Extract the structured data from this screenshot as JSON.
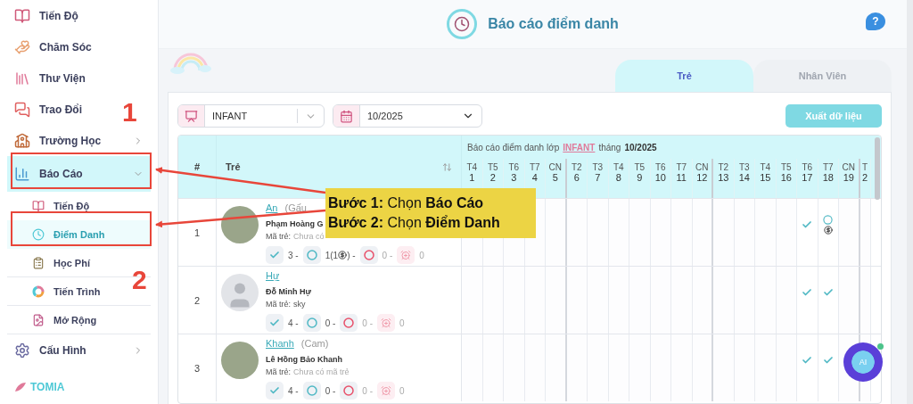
{
  "sidebar": {
    "items": [
      {
        "label": "Tiến Độ",
        "selected": false
      },
      {
        "label": "Chăm Sóc",
        "selected": false
      },
      {
        "label": "Thư Viện",
        "selected": false
      },
      {
        "label": "Trao Đổi",
        "selected": false
      },
      {
        "label": "Trường Học",
        "selected": false,
        "expanded": false
      },
      {
        "label": "Báo Cáo",
        "selected": true,
        "expanded": true,
        "children": [
          {
            "label": "Tiến Độ",
            "selected": false
          },
          {
            "label": "Điểm Danh",
            "selected": true
          },
          {
            "label": "Học Phí",
            "selected": false
          },
          {
            "label": "Tiến Trình",
            "selected": false
          },
          {
            "label": "Mở Rộng",
            "selected": false
          }
        ]
      },
      {
        "label": "Cấu Hình",
        "selected": false,
        "expanded": false
      }
    ],
    "logo": "TOMIA"
  },
  "header": {
    "title": "Báo cáo điểm danh",
    "help": "?"
  },
  "tabs": [
    {
      "label": "Trẻ",
      "selected": true
    },
    {
      "label": "Nhân Viên",
      "selected": false
    }
  ],
  "filters": {
    "class": "INFANT",
    "month": "10/2025"
  },
  "export_button": "Xuất dữ liệu",
  "table": {
    "columns": [
      "#",
      "Trẻ"
    ],
    "caption": {
      "prefix": "Báo cáo điểm danh lớp",
      "class": "INFANT",
      "middle": "tháng",
      "month": "10/2025"
    },
    "days": [
      {
        "weekday": "T4",
        "day": "1",
        "week_end": false
      },
      {
        "weekday": "T5",
        "day": "2",
        "week_end": false
      },
      {
        "weekday": "T6",
        "day": "3",
        "week_end": false
      },
      {
        "weekday": "T7",
        "day": "4",
        "week_end": false
      },
      {
        "weekday": "CN",
        "day": "5",
        "week_end": true
      },
      {
        "weekday": "T2",
        "day": "6",
        "week_end": false
      },
      {
        "weekday": "T3",
        "day": "7",
        "week_end": false
      },
      {
        "weekday": "T4",
        "day": "8",
        "week_end": false
      },
      {
        "weekday": "T5",
        "day": "9",
        "week_end": false
      },
      {
        "weekday": "T6",
        "day": "10",
        "week_end": false
      },
      {
        "weekday": "T7",
        "day": "11",
        "week_end": false
      },
      {
        "weekday": "CN",
        "day": "12",
        "week_end": true
      },
      {
        "weekday": "T2",
        "day": "13",
        "week_end": false
      },
      {
        "weekday": "T3",
        "day": "14",
        "week_end": false
      },
      {
        "weekday": "T4",
        "day": "15",
        "week_end": false
      },
      {
        "weekday": "T5",
        "day": "16",
        "week_end": false
      },
      {
        "weekday": "T6",
        "day": "17",
        "week_end": false
      },
      {
        "weekday": "T7",
        "day": "18",
        "week_end": false
      },
      {
        "weekday": "CN",
        "day": "19",
        "week_end": true
      },
      {
        "weekday": "T",
        "day": "2",
        "week_end": false
      }
    ],
    "rows": [
      {
        "index": "1",
        "avatar": {
          "kind": "photo"
        },
        "name": "An",
        "nickname": "(Gấu",
        "full_name": "Phạm Hoàng G",
        "code_label": "Mã trẻ:",
        "code": "Chưa có",
        "code_empty": true,
        "summary": [
          {
            "kind": "present",
            "text": "3 -"
          },
          {
            "kind": "excused",
            "text": "1(1",
            "suffix": ") -"
          },
          {
            "kind": "absent",
            "text": "0 -"
          },
          {
            "kind": "leave",
            "text": "0"
          }
        ],
        "cells": [
          {
            "kind": "empty"
          },
          {
            "kind": "empty"
          },
          {
            "kind": "empty"
          },
          {
            "kind": "empty"
          },
          {
            "kind": "empty"
          },
          {
            "kind": "empty"
          },
          {
            "kind": "empty"
          },
          {
            "kind": "empty"
          },
          {
            "kind": "empty"
          },
          {
            "kind": "empty"
          },
          {
            "kind": "empty"
          },
          {
            "kind": "empty"
          },
          {
            "kind": "empty"
          },
          {
            "kind": "empty"
          },
          {
            "kind": "empty"
          },
          {
            "kind": "empty"
          },
          {
            "kind": "present"
          },
          {
            "kind": "excused_refund"
          },
          {
            "kind": "empty"
          },
          {
            "kind": "empty"
          }
        ]
      },
      {
        "index": "2",
        "avatar": {
          "kind": "silhouette"
        },
        "name": "Hự",
        "full_name": "Đỗ Minh Hự",
        "code_label": "Mã trẻ:",
        "code": "sky",
        "code_empty": false,
        "summary": [
          {
            "kind": "present",
            "text": "4 -"
          },
          {
            "kind": "excused",
            "text": "0 -"
          },
          {
            "kind": "absent",
            "text": "0 -"
          },
          {
            "kind": "leave",
            "text": "0"
          }
        ],
        "cells": [
          {
            "kind": "empty"
          },
          {
            "kind": "empty"
          },
          {
            "kind": "empty"
          },
          {
            "kind": "empty"
          },
          {
            "kind": "empty"
          },
          {
            "kind": "empty"
          },
          {
            "kind": "empty"
          },
          {
            "kind": "empty"
          },
          {
            "kind": "empty"
          },
          {
            "kind": "empty"
          },
          {
            "kind": "empty"
          },
          {
            "kind": "empty"
          },
          {
            "kind": "empty"
          },
          {
            "kind": "empty"
          },
          {
            "kind": "empty"
          },
          {
            "kind": "empty"
          },
          {
            "kind": "present"
          },
          {
            "kind": "present"
          },
          {
            "kind": "empty"
          },
          {
            "kind": "empty"
          }
        ]
      },
      {
        "index": "3",
        "avatar": {
          "kind": "photo"
        },
        "name": "Khanh",
        "nickname": "(Cam)",
        "full_name": "Lê Hồng Bảo Khanh",
        "code_label": "Mã trẻ:",
        "code": "Chưa có mã trẻ",
        "code_empty": true,
        "summary": [
          {
            "kind": "present",
            "text": "4 -"
          },
          {
            "kind": "excused",
            "text": "0 -"
          },
          {
            "kind": "absent",
            "text": "0 -"
          },
          {
            "kind": "leave",
            "text": "0"
          }
        ],
        "cells": [
          {
            "kind": "empty"
          },
          {
            "kind": "empty"
          },
          {
            "kind": "empty"
          },
          {
            "kind": "empty"
          },
          {
            "kind": "empty"
          },
          {
            "kind": "empty"
          },
          {
            "kind": "empty"
          },
          {
            "kind": "empty"
          },
          {
            "kind": "empty"
          },
          {
            "kind": "empty"
          },
          {
            "kind": "empty"
          },
          {
            "kind": "empty"
          },
          {
            "kind": "empty"
          },
          {
            "kind": "empty"
          },
          {
            "kind": "empty"
          },
          {
            "kind": "empty"
          },
          {
            "kind": "present"
          },
          {
            "kind": "present"
          },
          {
            "kind": "empty"
          },
          {
            "kind": "empty"
          }
        ]
      }
    ]
  },
  "ai_button": "AI",
  "annotations": {
    "step_numbers": [
      "1",
      "2"
    ],
    "callout": [
      "**Bước 1:** Chọn **Báo Cáo**",
      "**Bước 2:** Chọn **Điểm Danh**"
    ]
  }
}
